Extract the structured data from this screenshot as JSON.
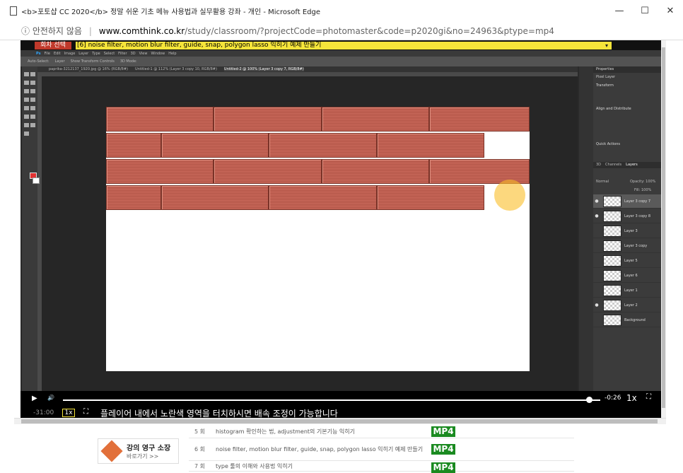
{
  "window": {
    "title": "<b>포토샵 CC 2020</b> 정말 쉬운 기초 메뉴 사용법과 실무활용 강좌 - 개인 - Microsoft Edge",
    "minimize": "—",
    "maximize": "☐",
    "close": "✕"
  },
  "address": {
    "security": "ⓘ 안전하지 않음",
    "separator": "|",
    "domain": "www.comthink.co.kr",
    "path": "/study/classroom/?projectCode=photomaster&code=p2020gi&no=24963&ptype=mp4"
  },
  "player": {
    "lecture_select": "회차 선택",
    "current_lecture": "[6] noise filter, motion blur filter, guide, snap, polygon lasso 익히기 예제 만들기",
    "dropdown_icon": "▾",
    "play_icon": "▶",
    "volume_icon": "🔊",
    "elapsed": "-0:26",
    "speed": "1x",
    "fullscreen_icon": "⛶",
    "rewind": "-31:00",
    "speed_box": "1x",
    "notice": "플레이어 내에서 노란색 영역을 터치하시면 배속 조정이 가능합니다"
  },
  "photoshop": {
    "menu": [
      "Ps",
      "File",
      "Edit",
      "Image",
      "Layer",
      "Type",
      "Select",
      "Filter",
      "3D",
      "View",
      "Window",
      "Help"
    ],
    "options": [
      "Auto-Select:",
      "Layer",
      "Show Transform Controls",
      "3D Mode:"
    ],
    "tabs": [
      {
        "label": "paprika-3212137_1920.jpg @ 16% (RGB/8#)",
        "active": false
      },
      {
        "label": "Untitled-1 @ 112% (Layer 3 copy 10, RGB/8#)",
        "active": false
      },
      {
        "label": "Untitled-2 @ 100% (Layer 3 copy 7, RGB/8#)",
        "active": true
      }
    ],
    "properties": {
      "title": "Properties",
      "pixel_layer": "Pixel Layer",
      "transform": "Transform",
      "align": "Align and Distribute",
      "quick_actions": "Quick Actions"
    },
    "layers_tabs": [
      "3D",
      "Channels",
      "Layers"
    ],
    "blend_mode": "Normal",
    "opacity": "Opacity: 100%",
    "fill": "Fill: 100%",
    "layers": [
      {
        "name": "Layer 3 copy 7",
        "visible": true,
        "selected": true
      },
      {
        "name": "Layer 3 copy 8",
        "visible": true,
        "selected": false
      },
      {
        "name": "Layer 3",
        "visible": false,
        "selected": false
      },
      {
        "name": "Layer 3 copy",
        "visible": false,
        "selected": false
      },
      {
        "name": "Layer 5",
        "visible": false,
        "selected": false
      },
      {
        "name": "Layer 6",
        "visible": false,
        "selected": false
      },
      {
        "name": "Layer 1",
        "visible": false,
        "selected": false
      },
      {
        "name": "Layer 2",
        "visible": true,
        "selected": false
      },
      {
        "name": "Background",
        "visible": false,
        "selected": false
      }
    ]
  },
  "lessons": [
    {
      "num": "5 회",
      "title": "histogram 확인하는 법, adjustment의 기본기능 익히기",
      "format": "MP4"
    },
    {
      "num": "6 회",
      "title": "noise filter, motion blur filter, guide, snap, polygon lasso 익히기 예제 만들기",
      "format": "MP4"
    },
    {
      "num": "7 회",
      "title": "type 툴의 이해와 사용법 익히기",
      "format": "MP4"
    }
  ],
  "promo": {
    "title": "강의 영구 소장",
    "subtitle": "바로가기 >>"
  }
}
